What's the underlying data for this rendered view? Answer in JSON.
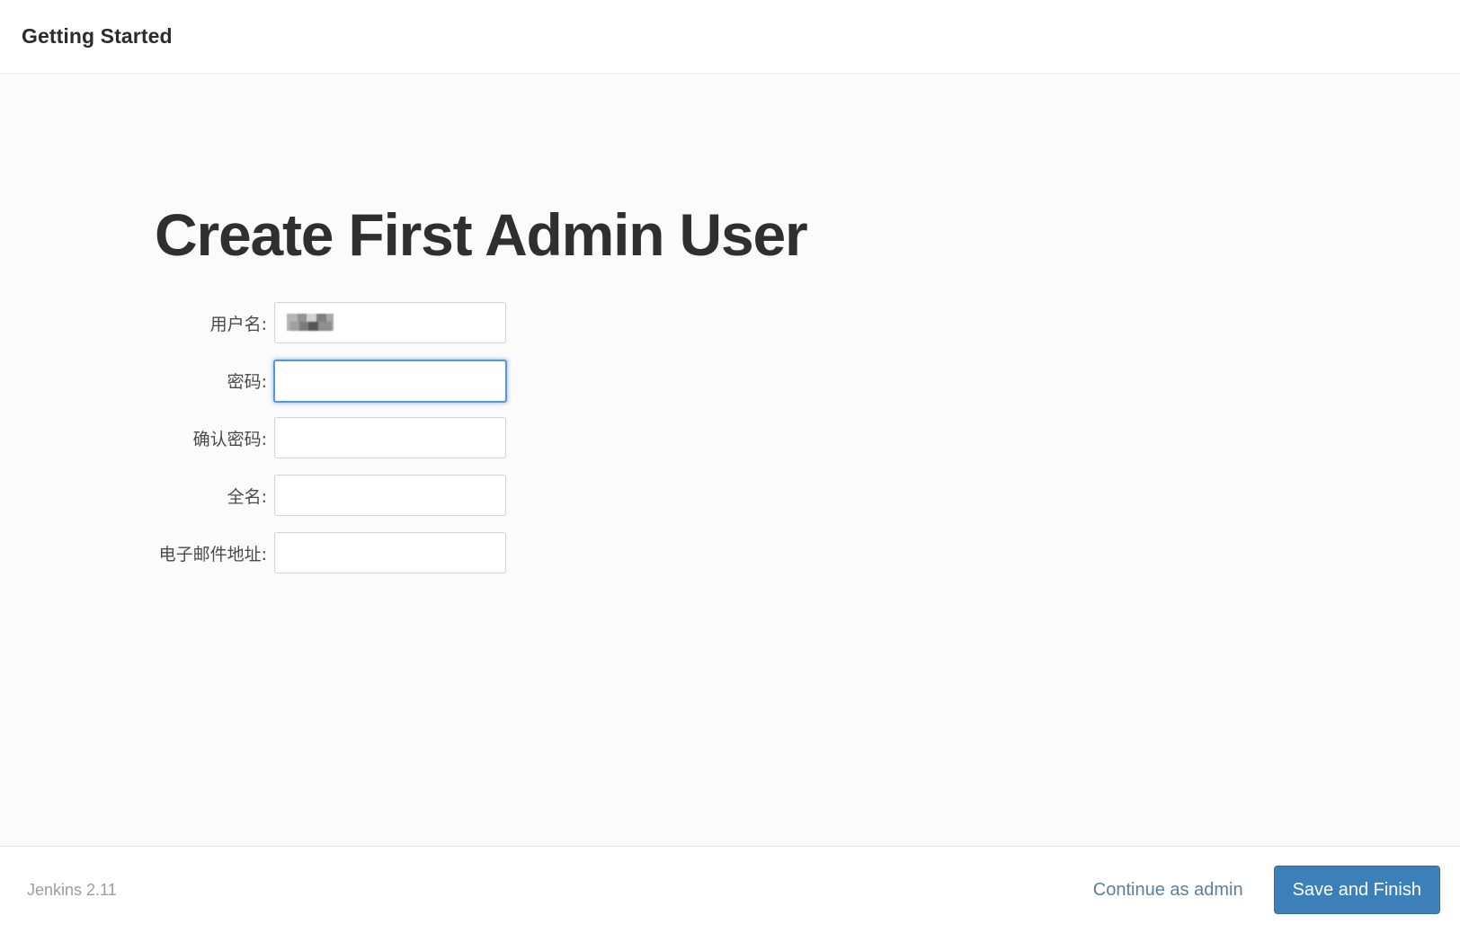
{
  "header": {
    "title": "Getting Started"
  },
  "page": {
    "title": "Create First Admin User"
  },
  "form": {
    "fields": [
      {
        "label": "用户名:",
        "name": "username",
        "type": "text",
        "value": "",
        "placeholder": "",
        "redacted": true,
        "focused": false
      },
      {
        "label": "密码:",
        "name": "password",
        "type": "password",
        "value": "",
        "placeholder": "",
        "redacted": false,
        "focused": true
      },
      {
        "label": "确认密码:",
        "name": "confirm-password",
        "type": "password",
        "value": "",
        "placeholder": "",
        "redacted": false,
        "focused": false
      },
      {
        "label": "全名:",
        "name": "fullname",
        "type": "text",
        "value": "",
        "placeholder": "",
        "redacted": false,
        "focused": false
      },
      {
        "label": "电子邮件地址:",
        "name": "email",
        "type": "text",
        "value": "",
        "placeholder": "",
        "redacted": false,
        "focused": false
      }
    ]
  },
  "footer": {
    "version": "Jenkins 2.11",
    "continue_link": "Continue as admin",
    "save_button": "Save and Finish"
  },
  "colors": {
    "primary_button": "#3c7fb9",
    "focus_border": "#5596dd",
    "link": "#5d7f9c",
    "body_background": "#fbfbfb",
    "header_text": "#2b2b2b"
  }
}
